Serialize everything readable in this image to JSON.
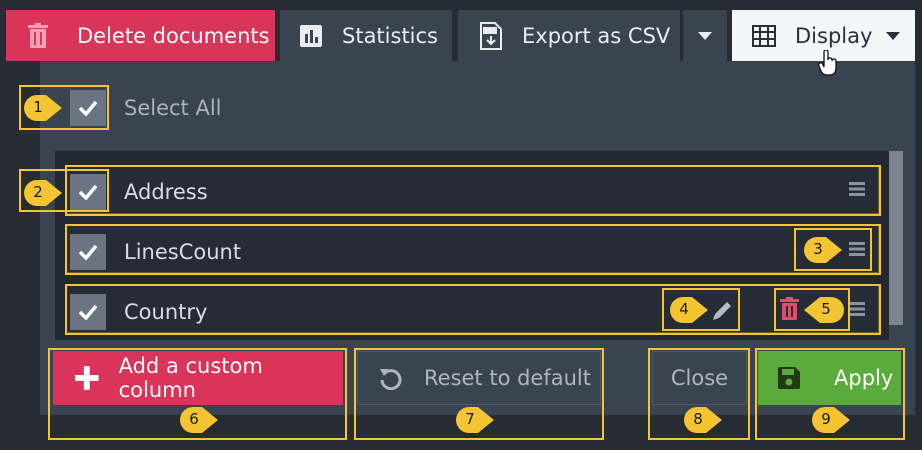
{
  "toolbar": {
    "delete_label": "Delete documents",
    "statistics_label": "Statistics",
    "export_label": "Export as CSV",
    "display_label": "Display"
  },
  "panel": {
    "select_all_label": "Select All",
    "columns": [
      {
        "label": "Address",
        "checked": true
      },
      {
        "label": "LinesCount",
        "checked": true
      },
      {
        "label": "Country",
        "checked": true
      }
    ],
    "add_custom_label": "Add a custom column",
    "reset_label": "Reset to default",
    "close_label": "Close",
    "apply_label": "Apply"
  },
  "annotations": [
    "1",
    "2",
    "3",
    "4",
    "5",
    "6",
    "7",
    "8",
    "9"
  ],
  "colors": {
    "danger": "#d9345a",
    "success": "#5aab3c",
    "panel": "#3a4350",
    "highlight": "#f3c532",
    "background": "#262b34"
  },
  "icons": [
    "trash-icon",
    "bar-chart-icon",
    "csv-file-icon",
    "chevron-down-icon",
    "table-grid-icon",
    "hand-cursor-icon",
    "check-icon",
    "drag-handle-icon",
    "pencil-icon",
    "plus-icon",
    "reset-icon",
    "save-icon"
  ]
}
